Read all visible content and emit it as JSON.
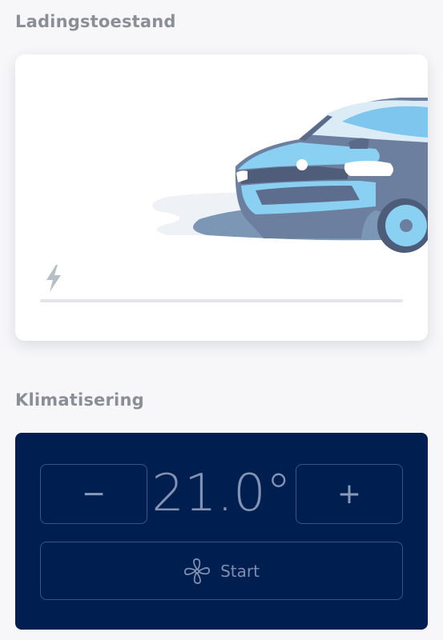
{
  "charging": {
    "section_title": "Ladingstoestand",
    "car_illustration": "car-front-icon",
    "charge_icon": "lightning-bolt-icon",
    "charge_level": 0
  },
  "climate": {
    "section_title": "Klimatisering",
    "decrease_label": "−",
    "increase_label": "+",
    "temperature": "21.0°",
    "start_label": "Start",
    "start_icon": "fan-icon"
  },
  "colors": {
    "background": "#f7f7f9",
    "climate_card": "#001e50",
    "car_accent": "#80c8f0",
    "car_body": "#6e7f9e"
  }
}
